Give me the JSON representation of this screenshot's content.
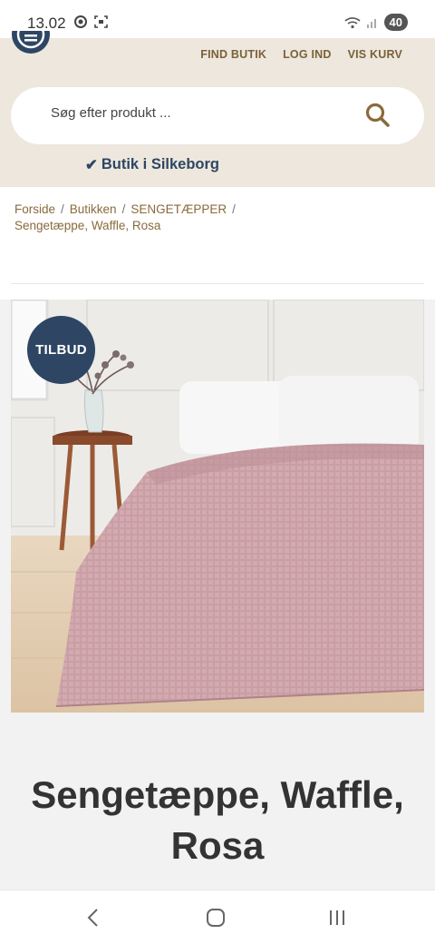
{
  "status": {
    "time": "13.02",
    "battery": "40"
  },
  "header": {
    "nav": [
      "FIND BUTIK",
      "LOG IND",
      "VIS KURV"
    ],
    "search_placeholder": "Søg efter produkt ...",
    "store_check": "✔",
    "store_text": "Butik i Silkeborg"
  },
  "breadcrumb": {
    "items": [
      "Forside",
      "Butikken",
      "SENGETÆPPER"
    ],
    "sep": "/",
    "current": "Sengetæppe, Waffle, Rosa"
  },
  "product": {
    "badge": "TILBUD",
    "title": "Sengetæppe, Waffle, Rosa"
  },
  "colors": {
    "navy": "#2e4663",
    "gold": "#7a6138",
    "header_bg": "#ede7dd",
    "blanket": "#c99ea4"
  }
}
